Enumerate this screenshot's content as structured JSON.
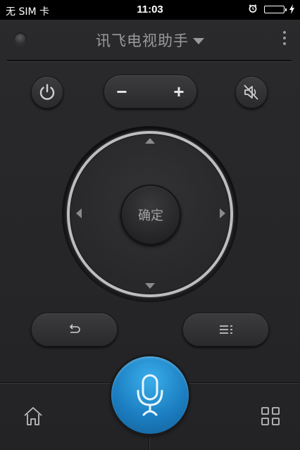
{
  "status_bar": {
    "carrier": "无 SIM 卡",
    "time": "11:03",
    "icons": [
      "alarm-icon",
      "battery-icon",
      "charging-bolt-icon"
    ]
  },
  "header": {
    "title": "讯飞电视助手",
    "icons": [
      "status-led-icon",
      "dropdown-caret-icon",
      "more-vertical-icon"
    ]
  },
  "controls": {
    "power_icon": "power-icon",
    "volume_minus": "−",
    "volume_plus": "+",
    "mute_icon": "mute-icon",
    "ok_label": "确定",
    "dpad_icons": [
      "arrow-up-icon",
      "arrow-down-icon",
      "arrow-left-icon",
      "arrow-right-icon"
    ],
    "back_icon": "back-icon",
    "menu_icon": "menu-icon"
  },
  "bottom_bar": {
    "home_icon": "home-icon",
    "mic_icon": "microphone-icon",
    "apps_icon": "apps-grid-icon"
  },
  "colors": {
    "background": "#252527",
    "mic_blue": "#1c7fc2",
    "ring_silver": "#bdbdbf",
    "text_gray": "#9a9a9c"
  }
}
